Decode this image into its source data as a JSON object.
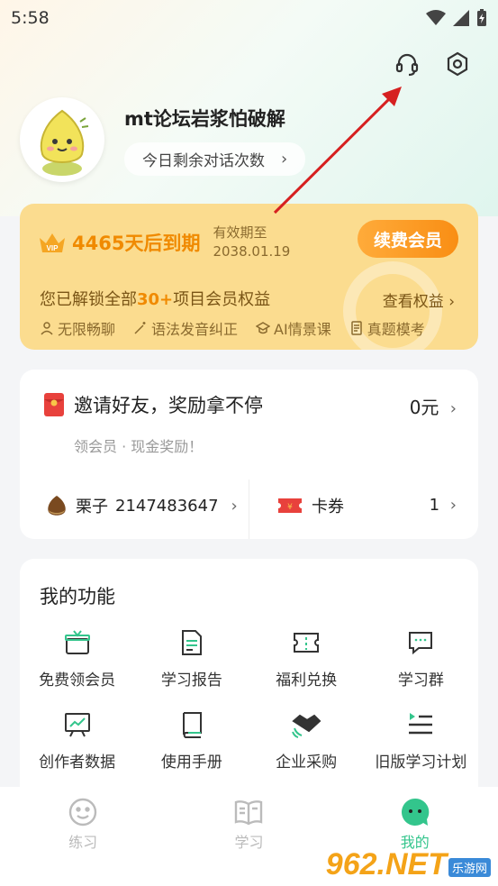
{
  "status_bar": {
    "time": "5:58"
  },
  "profile": {
    "username": "mt论坛岩浆怕破解",
    "chat_pill": "今日剩余对话次数"
  },
  "vip": {
    "days_left": "4465天后到期",
    "expire_label": "有效期至",
    "expire_date": "2038.01.19",
    "renew_label": "续费会员",
    "unlock_prefix": "您已解锁全部",
    "unlock_highlight": "30+",
    "unlock_suffix": "项目会员权益",
    "view_rights": "查看权益",
    "perks": [
      "无限畅聊",
      "语法发音纠正",
      "AI情景课",
      "真题模考"
    ]
  },
  "invite": {
    "title": "邀请好友，奖励拿不停",
    "amount": "0元",
    "subtitle": "领会员 · 现金奖励！",
    "chestnut_label": "栗子",
    "chestnut_value": "2147483647",
    "coupon_label": "卡券",
    "coupon_count": "1"
  },
  "functions": {
    "title": "我的功能",
    "items": [
      {
        "label": "免费领会员",
        "icon": "gift-box-icon"
      },
      {
        "label": "学习报告",
        "icon": "report-doc-icon"
      },
      {
        "label": "福利兑换",
        "icon": "ticket-icon"
      },
      {
        "label": "学习群",
        "icon": "chat-bubble-icon"
      },
      {
        "label": "创作者数据",
        "icon": "chart-board-icon"
      },
      {
        "label": "使用手册",
        "icon": "manual-book-icon"
      },
      {
        "label": "企业采购",
        "icon": "handshake-icon"
      },
      {
        "label": "旧版学习计划",
        "icon": "plan-list-icon"
      }
    ]
  },
  "tabs": [
    {
      "label": "练习",
      "icon": "smile-face-icon"
    },
    {
      "label": "学习",
      "icon": "open-book-icon"
    },
    {
      "label": "我的",
      "icon": "mascot-chat-icon"
    }
  ],
  "watermark": {
    "logo": "962.NET",
    "sub": "乐游网"
  },
  "colors": {
    "accent_green": "#33c58c",
    "vip_gold": "#fbdc8f",
    "vip_orange": "#f08a00",
    "annotation_red": "#d62020"
  }
}
